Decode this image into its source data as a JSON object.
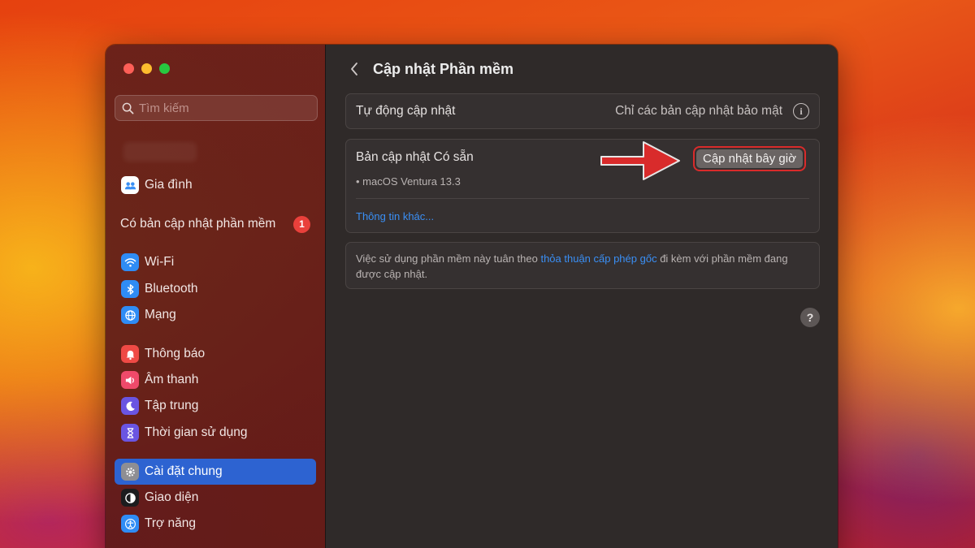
{
  "sidebar": {
    "search_placeholder": "Tìm kiếm",
    "family": {
      "label": "Gia đình",
      "icon": "family-icon"
    },
    "update_notice": {
      "label": "Có bản cập nhật phần mềm",
      "badge": "1"
    },
    "items": [
      {
        "label": "Wi-Fi",
        "icon": "wifi-icon",
        "color": "#2f8cf5"
      },
      {
        "label": "Bluetooth",
        "icon": "bluetooth-icon",
        "color": "#2f8cf5"
      },
      {
        "label": "Mạng",
        "icon": "globe-icon",
        "color": "#2f8cf5"
      },
      {
        "label": "Thông báo",
        "icon": "bell-icon",
        "color": "#ef4a45"
      },
      {
        "label": "Âm thanh",
        "icon": "speaker-icon",
        "color": "#ef4a6a"
      },
      {
        "label": "Tập trung",
        "icon": "moon-icon",
        "color": "#6a55e2"
      },
      {
        "label": "Thời gian sử dụng",
        "icon": "hourglass-icon",
        "color": "#6a55e2"
      },
      {
        "label": "Cài đặt chung",
        "icon": "gear-icon",
        "color": "#8e8e93",
        "active": true
      },
      {
        "label": "Giao diện",
        "icon": "appearance-icon",
        "color": "#1c1c1e"
      },
      {
        "label": "Trợ năng",
        "icon": "accessibility-icon",
        "color": "#2f8cf5"
      }
    ]
  },
  "header": {
    "title": "Cập nhật Phần mềm"
  },
  "auto_update": {
    "label": "Tự động cập nhật",
    "value": "Chỉ các bản cập nhật bảo mật",
    "info": "i"
  },
  "available": {
    "title": "Bản cập nhật Có sẵn",
    "item": "• macOS Ventura 13.3",
    "button": "Cập nhật bây giờ",
    "more_link": "Thông tin khác..."
  },
  "license": {
    "prefix": "Việc sử dụng phần mềm này tuân theo ",
    "link": "thỏa thuận cấp phép gốc",
    "suffix": " đi kèm với phần mềm đang được cập nhật."
  },
  "help": {
    "label": "?"
  },
  "colors": {
    "accent": "#2d63d1",
    "link": "#3a8ff5",
    "annotation": "#d92b2b"
  }
}
